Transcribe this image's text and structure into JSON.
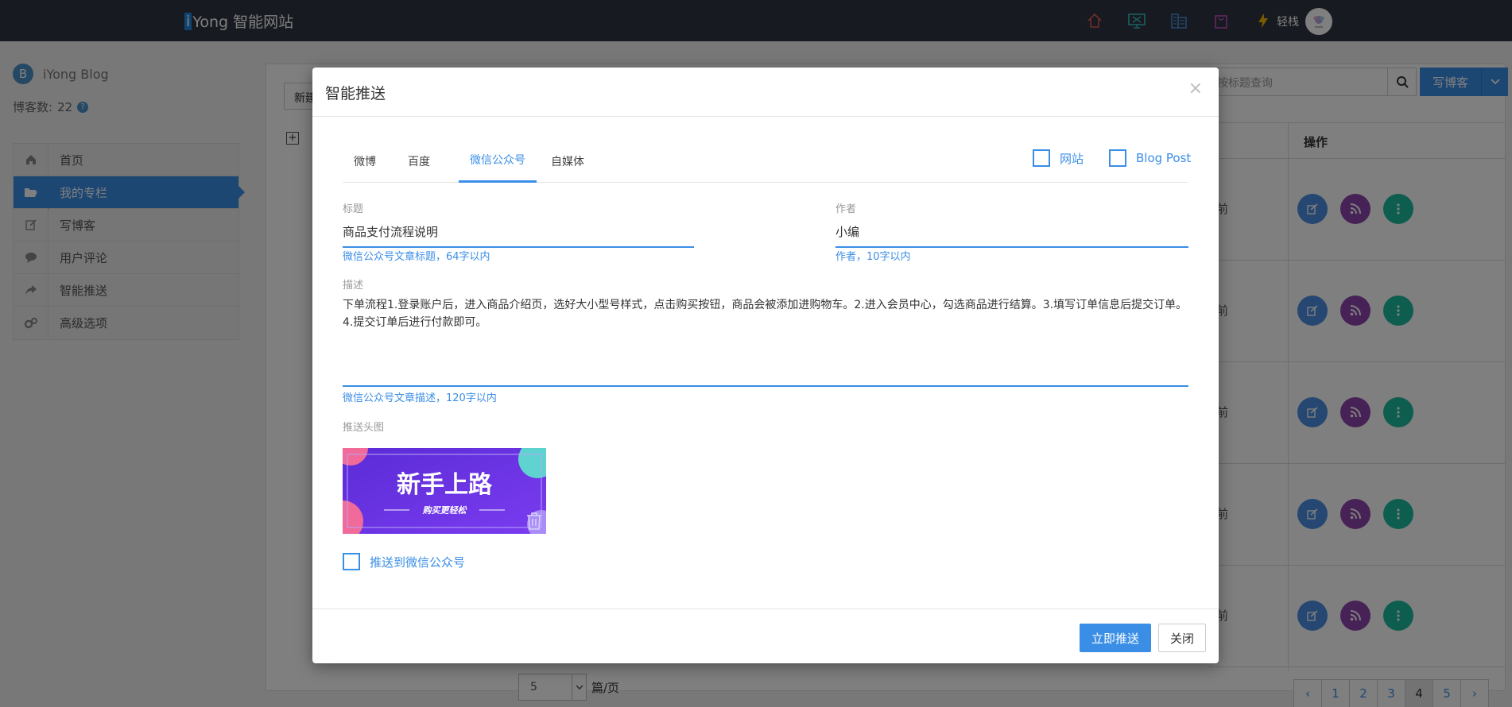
{
  "topbar": {
    "brand_i": "i",
    "brand_rest": "Yong 智能网站",
    "user_name": "轻栈",
    "icons": [
      "home-icon",
      "monitor-icon",
      "building-icon",
      "bag-icon",
      "lightning-icon"
    ]
  },
  "sidebar": {
    "blog_logo": "B",
    "blog_name": "iYong Blog",
    "count_label": "博客数:",
    "count_value": "22",
    "help": "?",
    "items": [
      {
        "label": "首页",
        "icon": "home-icon"
      },
      {
        "label": "我的专栏",
        "icon": "folder-open-icon"
      },
      {
        "label": "写博客",
        "icon": "edit-icon"
      },
      {
        "label": "用户评论",
        "icon": "comment-icon"
      },
      {
        "label": "智能推送",
        "icon": "share-icon"
      },
      {
        "label": "高级选项",
        "icon": "cogs-icon"
      }
    ]
  },
  "main": {
    "new_button": "新建",
    "tree_toggle": "+",
    "search_placeholder": "按标题查询",
    "write_button": "写博客",
    "op_header": "操作",
    "row_suffix": "前",
    "page_size": "5",
    "page_unit": "篇/页",
    "pages": [
      "‹",
      "1",
      "2",
      "3",
      "4",
      "5",
      "›"
    ],
    "active_page": "4"
  },
  "modal": {
    "title": "智能推送",
    "close": "×",
    "tabs": [
      "微博",
      "百度",
      "微信公众号",
      "自媒体"
    ],
    "active_tab": "微信公众号",
    "check_site": "网站",
    "check_blogpost": "Blog Post",
    "title_label": "标题",
    "title_value": "商品支付流程说明",
    "title_hint": "微信公众号文章标题，64字以内",
    "author_label": "作者",
    "author_value": "小编",
    "author_hint": "作者，10字以内",
    "desc_label": "描述",
    "desc_value": "下单流程1.登录账户后，进入商品介绍页，选好大小型号样式，点击购买按钮，商品会被添加进购物车。2.进入会员中心，勾选商品进行结算。3.填写订单信息后提交订单。4.提交订单后进行付款即可。",
    "desc_hint": "微信公众号文章描述，120字以内",
    "cover_label": "推送头图",
    "cover_title": "新手上路",
    "cover_subtitle": "购买更轻松",
    "push_wechat": "推送到微信公众号",
    "push_button": "立即推送",
    "close_button": "关闭"
  }
}
